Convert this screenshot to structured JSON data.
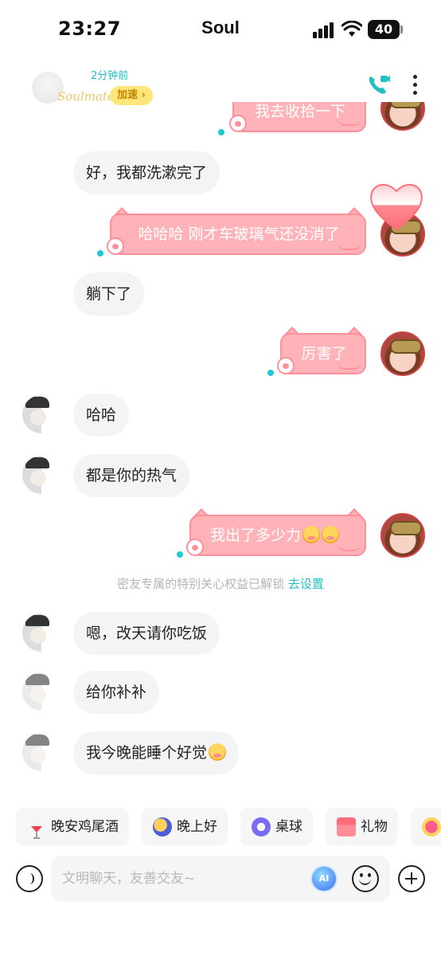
{
  "status_bar": {
    "time": "23:27",
    "carrier": "Soul",
    "battery": "40"
  },
  "header": {
    "last_seen": "2分钟前",
    "soulmate_tag": "Soulmate",
    "boost_label": "加速 ›",
    "call_icon": "phone-video-icon",
    "more_icon": "more-vertical-icon"
  },
  "messages": [
    {
      "from": "me",
      "text": "我去收拾一下"
    },
    {
      "from": "other",
      "text": "好，我都洗漱完了"
    },
    {
      "from": "me",
      "text": "哈哈哈 刚才车玻璃气还没消了"
    },
    {
      "from": "other",
      "text": "躺下了"
    },
    {
      "from": "me",
      "text": "厉害了"
    },
    {
      "from": "other",
      "text": "哈哈"
    },
    {
      "from": "other",
      "text": "都是你的热气"
    },
    {
      "from": "me",
      "text": "我出了多少力"
    },
    {
      "from": "other",
      "text": "嗯，改天请你吃饭"
    },
    {
      "from": "other",
      "text": "给你补补"
    },
    {
      "from": "other",
      "text": "我今晚能睡个好觉"
    }
  ],
  "system_note": {
    "text": "密友专属的特别关心权益已解锁",
    "link": "去设置"
  },
  "quick_actions": [
    {
      "label": "晚安鸡尾酒",
      "icon": "cocktail-icon"
    },
    {
      "label": "晚上好",
      "icon": "moon-icon"
    },
    {
      "label": "桌球",
      "icon": "billiard-ball-icon"
    },
    {
      "label": "礼物",
      "icon": "gift-icon"
    },
    {
      "label": "",
      "icon": "heart-emoji-icon"
    }
  ],
  "input": {
    "placeholder": "文明聊天，友善交友~",
    "ai_label": "AI"
  },
  "colors": {
    "accent": "#22bfc7",
    "bubble_out": "#ffb3b8",
    "bubble_out_border": "#ff8f9a",
    "bubble_in": "#f4f4f6"
  }
}
